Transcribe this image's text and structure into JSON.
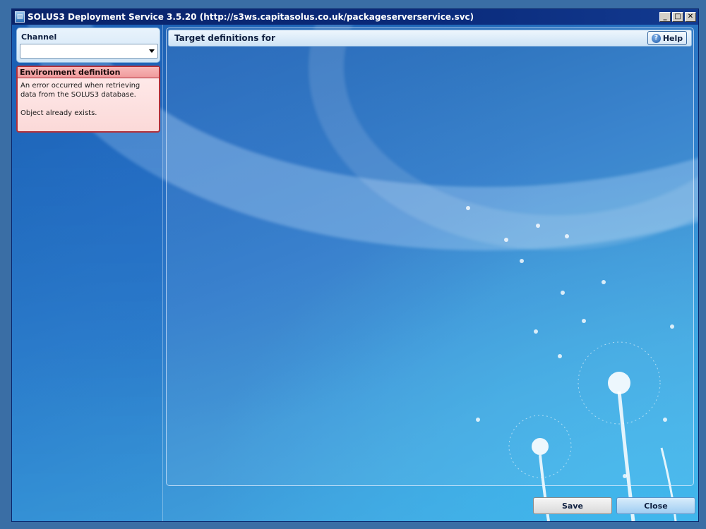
{
  "window": {
    "title": "SOLUS3 Deployment Service 3.5.20 (http://s3ws.capitasolus.co.uk/packageserverservice.svc)",
    "controls": {
      "minimize": "_",
      "maximize": "□",
      "close": "✕"
    }
  },
  "sidebar": {
    "channel_label": "Channel",
    "channel_value": "",
    "environment": {
      "header": "Environment definition",
      "message_line1": "An error occurred when retrieving data from the SOLUS3 database.",
      "message_line2": "Object already exists."
    }
  },
  "main": {
    "title": "Target definitions for",
    "help_label": "Help"
  },
  "footer": {
    "save_label": "Save",
    "close_label": "Close"
  },
  "colors": {
    "title_bar": "#0a246a",
    "error_border": "#b0303a",
    "error_fill": "#fbd9d8",
    "background_accent": "#3fb6ec"
  },
  "icons": [
    "app-icon",
    "dropdown-arrow-icon",
    "help-icon",
    "minimize-icon",
    "maximize-icon",
    "close-icon"
  ]
}
